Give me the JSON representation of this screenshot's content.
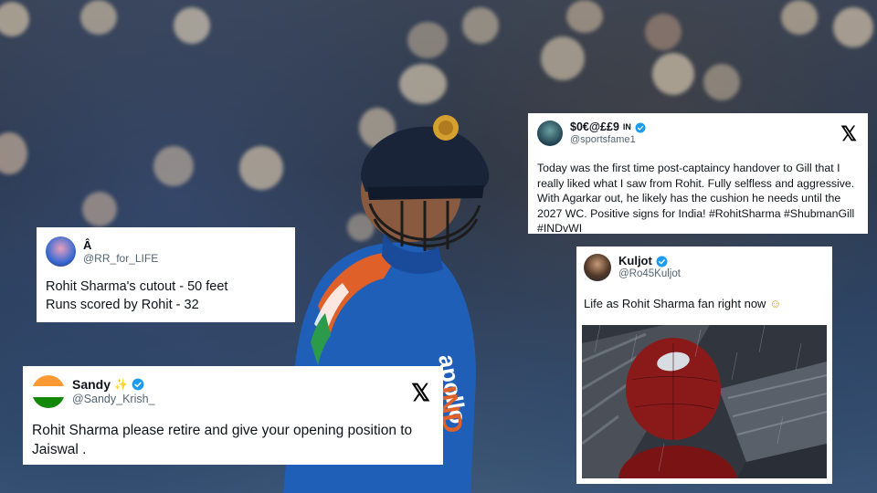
{
  "tweets": {
    "rr": {
      "name": "Â",
      "handle": "@RR_for_LIFE",
      "line1": "Rohit Sharma's cutout - 50 feet",
      "line2": "Runs scored by Rohit - 32"
    },
    "sandy": {
      "name": "Sandy",
      "emoji": "✨",
      "handle": "@Sandy_Krish_",
      "text": "Rohit Sharma please retire and give your opening position to Jaiswal ."
    },
    "sportsfame": {
      "name": "$0€@££9",
      "flag": "IN",
      "handle": "@sportsfame1",
      "text": "Today was the first time post-captaincy handover to Gill that I really liked what I saw from Rohit. Fully selfless and aggressive. With Agarkar out, he likely has the cushion he needs until the 2027 WC. Positive signs for India! #RohitSharma #ShubmanGill #INDvWI"
    },
    "kuljot": {
      "name": "Kuljot",
      "handle": "@Ro45Kuljot",
      "text": "Life as Rohit Sharma fan right now",
      "emoji": "☺"
    }
  },
  "x_logo": "𝕏",
  "colors": {
    "verified": "#1d9bf0",
    "jersey": "#1f5fb8",
    "helmet": "#1a2438"
  }
}
